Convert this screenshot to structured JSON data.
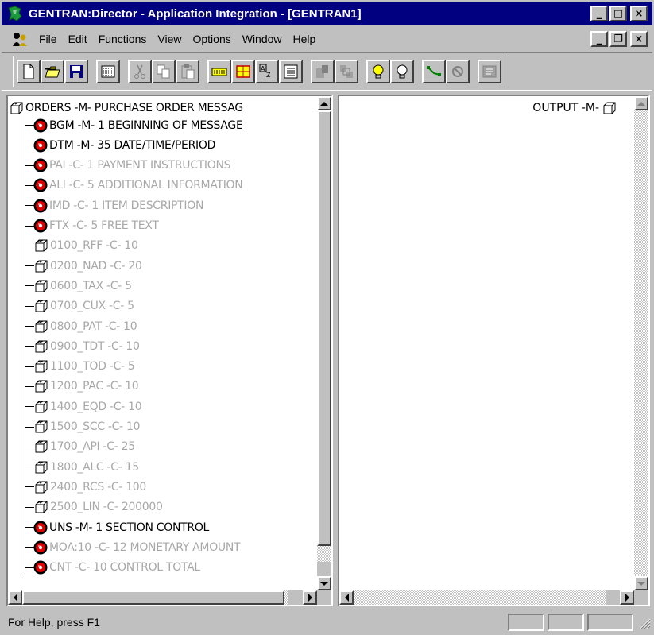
{
  "window": {
    "title": "GENTRAN:Director - Application Integration - [GENTRAN1]",
    "controls": {
      "minimize": "_",
      "maximize": "□",
      "close": "×"
    }
  },
  "menu": {
    "items": [
      {
        "label": "File"
      },
      {
        "label": "Edit"
      },
      {
        "label": "Functions"
      },
      {
        "label": "View"
      },
      {
        "label": "Options"
      },
      {
        "label": "Window"
      },
      {
        "label": "Help"
      }
    ],
    "child_controls": {
      "minimize": "_",
      "restore": "❐",
      "close": "×"
    }
  },
  "toolbar": {
    "buttons": [
      {
        "name": "new-icon"
      },
      {
        "name": "open-icon"
      },
      {
        "name": "save-icon"
      },
      {
        "name": "properties-icon"
      },
      {
        "name": "cut-icon"
      },
      {
        "name": "copy-icon"
      },
      {
        "name": "paste-icon"
      },
      {
        "name": "insert-record-icon"
      },
      {
        "name": "insert-field-icon"
      },
      {
        "name": "sort-icon"
      },
      {
        "name": "list-icon"
      },
      {
        "name": "promote-icon"
      },
      {
        "name": "demote-icon"
      },
      {
        "name": "activate-icon"
      },
      {
        "name": "deactivate-icon"
      },
      {
        "name": "link-icon"
      },
      {
        "name": "unlink-icon"
      },
      {
        "name": "compile-icon"
      }
    ]
  },
  "left_tree": {
    "root": "ORDERS -M- PURCHASE ORDER MESSAG",
    "items": [
      {
        "kind": "segment",
        "label": "BGM -M- 1 BEGINNING OF MESSAGE",
        "active": true
      },
      {
        "kind": "segment",
        "label": "DTM -M- 35 DATE/TIME/PERIOD",
        "active": true
      },
      {
        "kind": "segment",
        "label": "PAI -C- 1 PAYMENT INSTRUCTIONS",
        "active": false
      },
      {
        "kind": "segment",
        "label": "ALI -C- 5 ADDITIONAL INFORMATION",
        "active": false
      },
      {
        "kind": "segment",
        "label": "IMD -C- 1 ITEM DESCRIPTION",
        "active": false
      },
      {
        "kind": "segment",
        "label": "FTX -C- 5 FREE TEXT",
        "active": false
      },
      {
        "kind": "group",
        "label": "0100_RFF -C- 10",
        "active": false
      },
      {
        "kind": "group",
        "label": "0200_NAD -C- 20",
        "active": false
      },
      {
        "kind": "group",
        "label": "0600_TAX -C- 5",
        "active": false
      },
      {
        "kind": "group",
        "label": "0700_CUX -C- 5",
        "active": false
      },
      {
        "kind": "group",
        "label": "0800_PAT -C- 10",
        "active": false
      },
      {
        "kind": "group",
        "label": "0900_TDT -C- 10",
        "active": false
      },
      {
        "kind": "group",
        "label": "1100_TOD -C- 5",
        "active": false
      },
      {
        "kind": "group",
        "label": "1200_PAC -C- 10",
        "active": false
      },
      {
        "kind": "group",
        "label": "1400_EQD -C- 10",
        "active": false
      },
      {
        "kind": "group",
        "label": "1500_SCC -C- 10",
        "active": false
      },
      {
        "kind": "group",
        "label": "1700_API -C- 25",
        "active": false
      },
      {
        "kind": "group",
        "label": "1800_ALC -C- 15",
        "active": false
      },
      {
        "kind": "group",
        "label": "2400_RCS -C- 100",
        "active": false
      },
      {
        "kind": "group",
        "label": "2500_LIN -C- 200000",
        "active": false
      },
      {
        "kind": "segment",
        "label": "UNS -M- 1 SECTION CONTROL",
        "active": true
      },
      {
        "kind": "segment",
        "label": "MOA:10 -C- 12 MONETARY AMOUNT",
        "active": false
      },
      {
        "kind": "segment",
        "label": "CNT -C- 10 CONTROL TOTAL",
        "active": false
      }
    ]
  },
  "right_tree": {
    "root": "OUTPUT -M-"
  },
  "status": {
    "text": "For Help, press F1"
  },
  "colors": {
    "titlebar": "#000080",
    "face": "#c0c0c0",
    "inactive_text": "#a8a8a8",
    "segment_icon_red": "#e00000"
  }
}
